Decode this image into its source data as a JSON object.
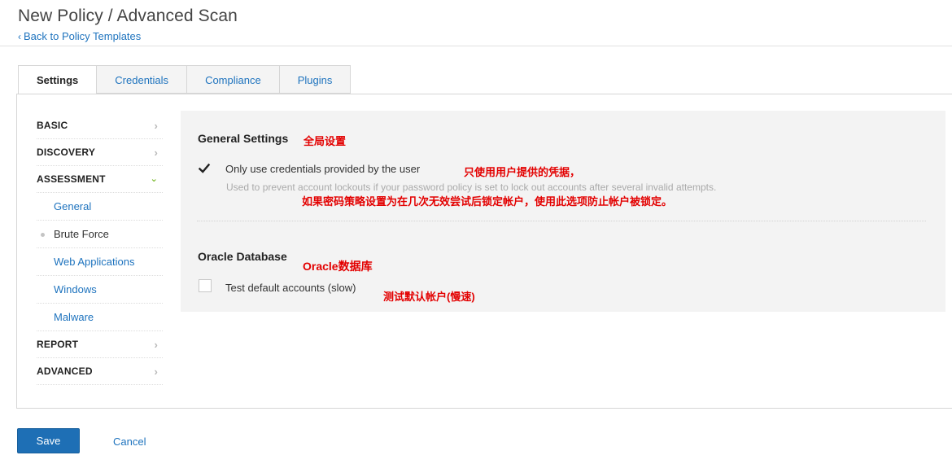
{
  "header": {
    "title": "New Policy / Advanced Scan",
    "back_link": "Back to Policy Templates"
  },
  "tabs": [
    {
      "label": "Settings",
      "active": true
    },
    {
      "label": "Credentials",
      "active": false
    },
    {
      "label": "Compliance",
      "active": false
    },
    {
      "label": "Plugins",
      "active": false
    }
  ],
  "sidebar": {
    "basic": "BASIC",
    "discovery": "DISCOVERY",
    "assessment": "ASSESSMENT",
    "assessment_items": [
      "General",
      "Brute Force",
      "Web Applications",
      "Windows",
      "Malware"
    ],
    "active_item": "Brute Force",
    "report": "REPORT",
    "advanced": "ADVANCED"
  },
  "general_settings": {
    "title": "General Settings",
    "title_note": "全局设置",
    "option_label": "Only use credentials provided by the user",
    "option_checked": true,
    "option_note": "只使用用户提供的凭据，",
    "help_text": "Used to prevent account lockouts if your password policy is set to lock out accounts after several invalid attempts.",
    "help_note": "如果密码策略设置为在几次无效尝试后锁定帐户，使用此选项防止帐户被锁定。"
  },
  "oracle_database": {
    "title": "Oracle Database",
    "title_note": "Oracle数据库",
    "option_label": "Test default accounts (slow)",
    "option_checked": false,
    "option_note": "测试默认帐户(慢速)"
  },
  "actions": {
    "save_label": "Save",
    "cancel_label": "Cancel"
  },
  "colors": {
    "link": "#1e73be",
    "save_button": "#1e6fb5",
    "annotation": "#e30000",
    "expanded_arrow": "#7ab92d"
  },
  "icons": {
    "back": "chevron-left-icon",
    "collapsed": "chevron-right-icon",
    "expanded": "chevron-down-icon",
    "checked": "checkmark-icon"
  }
}
